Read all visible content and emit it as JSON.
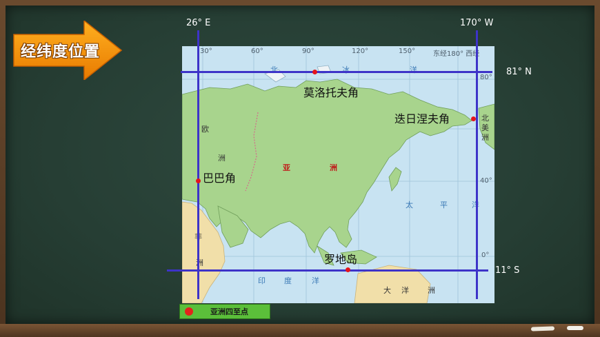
{
  "title": "经纬度位置",
  "coordinates": {
    "west": "26° E",
    "east": "170° W",
    "north": "81° N",
    "south": "11° S"
  },
  "map": {
    "ticks_top": [
      "30°",
      "60°",
      "90°",
      "120°",
      "150°",
      "东经180° 西经"
    ],
    "ticks_right": [
      "80°",
      "40°",
      "0°"
    ],
    "seas": [
      "北",
      "冰",
      "洋",
      "太",
      "平",
      "洋",
      "印",
      "度",
      "洋"
    ],
    "continents": {
      "europe": [
        "欧",
        "洲"
      ],
      "africa": [
        "非",
        "洲"
      ],
      "north_america": [
        "北",
        "美",
        "洲"
      ],
      "oceania": [
        "大",
        "洋",
        "洲"
      ],
      "asia": [
        "亚",
        "洲"
      ]
    }
  },
  "extreme_points": {
    "north": "莫洛托夫角",
    "east": "迭日涅夫角",
    "west": "巴巴角",
    "south": "罗地岛"
  },
  "legend": "亚洲四至点",
  "colors": {
    "line": "#3d33c8",
    "point": "#e5141b",
    "land": "#a8d48d",
    "sea": "#c8e3f2"
  }
}
